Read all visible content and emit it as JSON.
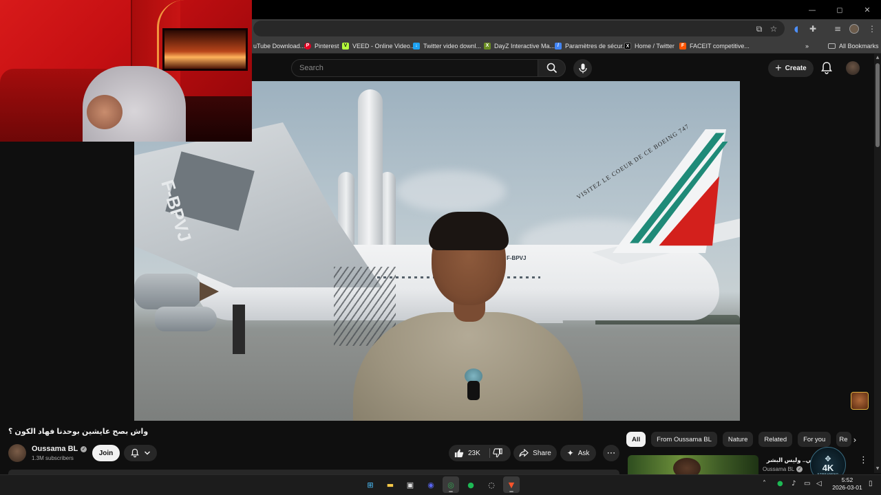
{
  "browser": {
    "window_controls": [
      "—",
      "◻",
      "✕"
    ],
    "bookmarks": [
      {
        "label": "uTube Download...",
        "icon": "youtube-download-icon",
        "color": "#3c3c3c"
      },
      {
        "label": "Pinterest",
        "icon": "pinterest-icon",
        "color": "#e60023"
      },
      {
        "label": "VEED - Online Video...",
        "icon": "veed-icon",
        "color": "#b6ff3b"
      },
      {
        "label": "Twitter video downl...",
        "icon": "twitter-video-icon",
        "color": "#1da1f2"
      },
      {
        "label": "DayZ Interactive Ma...",
        "icon": "dayz-icon",
        "color": "#6b8e23"
      },
      {
        "label": "Paramètres de sécur...",
        "icon": "security-settings-icon",
        "color": "#4285f4"
      },
      {
        "label": "Home / Twitter",
        "icon": "x-icon",
        "color": "#000000"
      },
      {
        "label": "FACEIT competitive...",
        "icon": "faceit-icon",
        "color": "#ff5500"
      }
    ],
    "all_bookmarks_label": "All Bookmarks"
  },
  "header": {
    "search_placeholder": "Search",
    "create_label": "Create"
  },
  "video": {
    "title": "واش بصح عايشين بوحدنا فهاد الكون ؟",
    "tail_text": "VISITEZ LE COEUR DE CE BOEING 747",
    "registration": "F-BPVJ",
    "wing_registration": "F-BPVJ"
  },
  "channel": {
    "name": "Oussama BL",
    "subscribers": "1.3M subscribers",
    "join_label": "Join"
  },
  "actions": {
    "likes": "23K",
    "share_label": "Share",
    "ask_label": "Ask",
    "more_label": "⋯"
  },
  "chips": [
    "All",
    "From Oussama BL",
    "Nature",
    "Related",
    "For you",
    "Re"
  ],
  "recommendation": {
    "title": "كم الحالي.. وليس البشر !",
    "channel": "Oussama BL"
  },
  "overlay_logo": {
    "text": "4K",
    "sub": "STREAMING"
  },
  "taskbar": {
    "apps": [
      {
        "name": "windows-start-icon",
        "glyph": "⊞",
        "color": "#4cc2ff"
      },
      {
        "name": "file-explorer-icon",
        "glyph": "▬",
        "color": "#f7c948"
      },
      {
        "name": "microsoft-store-icon",
        "glyph": "▣",
        "color": "#e0e0e0"
      },
      {
        "name": "discord-icon",
        "glyph": "◉",
        "color": "#5865f2"
      },
      {
        "name": "chrome-icon",
        "glyph": "◎",
        "color": "#34a853"
      },
      {
        "name": "spotify-icon",
        "glyph": "●",
        "color": "#1db954"
      },
      {
        "name": "obs-icon",
        "glyph": "◌",
        "color": "#e0e0e0"
      },
      {
        "name": "brave-icon",
        "glyph": "▼",
        "color": "#fb542b"
      }
    ],
    "time": "5:52",
    "date": "2026-03-01"
  }
}
